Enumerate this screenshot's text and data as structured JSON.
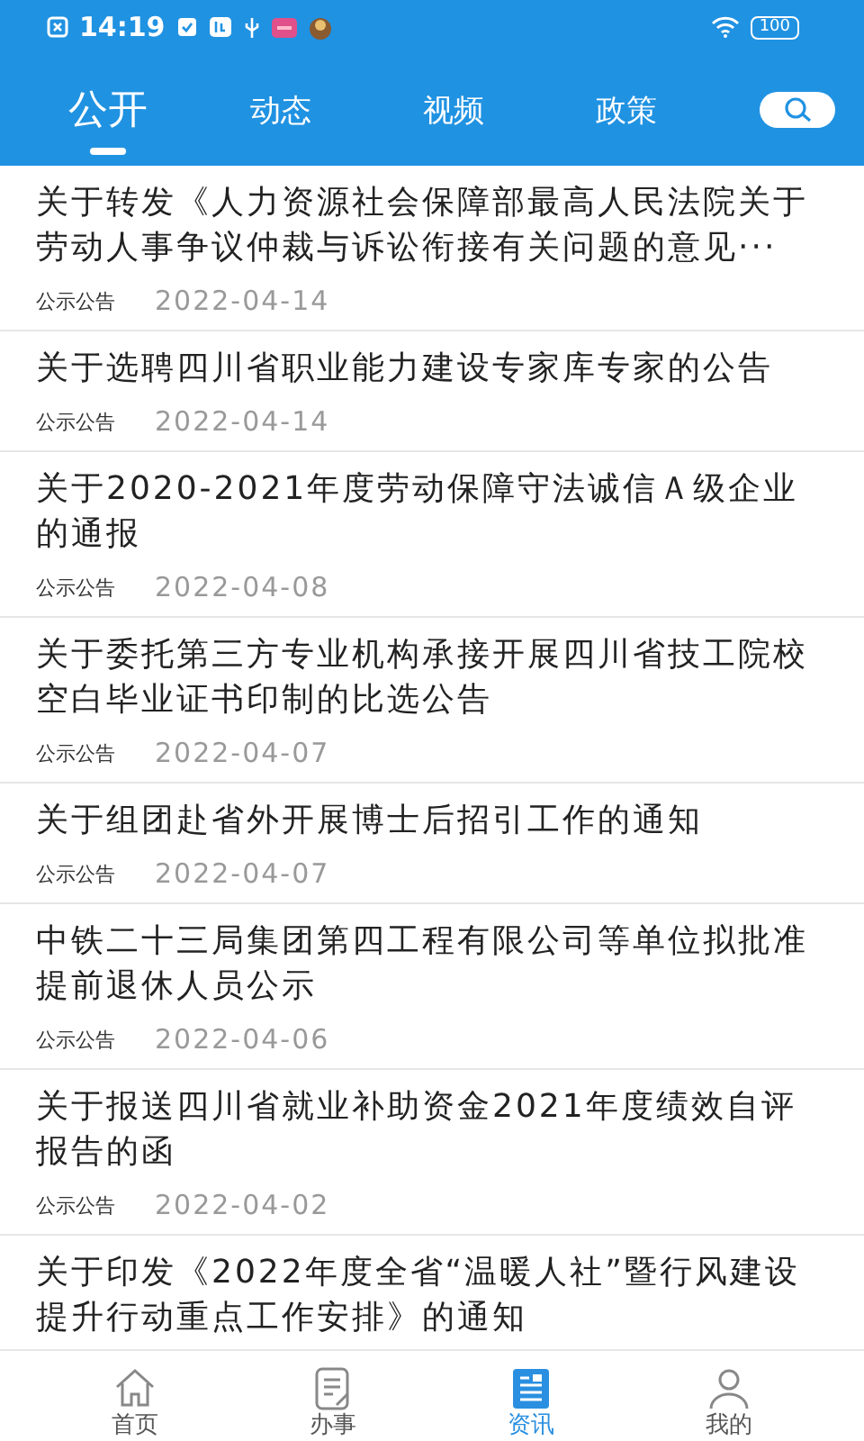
{
  "status_bar": {
    "time": "14:19",
    "battery": "100"
  },
  "tabs": [
    {
      "label": "公开",
      "selected": true
    },
    {
      "label": "动态",
      "selected": false
    },
    {
      "label": "视频",
      "selected": false
    },
    {
      "label": "政策",
      "selected": false
    }
  ],
  "articles": [
    {
      "title": "关于转发《人力资源社会保障部最高人民法院关于劳动人事争议仲裁与诉讼衔接有关问题的意见···",
      "category": "公示公告",
      "date": "2022-04-14"
    },
    {
      "title": "关于选聘四川省职业能力建设专家库专家的公告",
      "category": "公示公告",
      "date": "2022-04-14"
    },
    {
      "title": "关于2020-2021年度劳动保障守法诚信Ａ级企业的通报",
      "category": "公示公告",
      "date": "2022-04-08"
    },
    {
      "title": "关于委托第三方专业机构承接开展四川省技工院校空白毕业证书印制的比选公告",
      "category": "公示公告",
      "date": "2022-04-07"
    },
    {
      "title": "关于组团赴省外开展博士后招引工作的通知",
      "category": "公示公告",
      "date": "2022-04-07"
    },
    {
      "title": "中铁二十三局集团第四工程有限公司等单位拟批准提前退休人员公示",
      "category": "公示公告",
      "date": "2022-04-06"
    },
    {
      "title": "关于报送四川省就业补助资金2021年度绩效自评报告的函",
      "category": "公示公告",
      "date": "2022-04-02"
    },
    {
      "title": "关于印发《2022年度全省“温暖人社”暨行风建设提升行动重点工作安排》的通知"
    }
  ],
  "bottom_nav": [
    {
      "label": "首页",
      "selected": false
    },
    {
      "label": "办事",
      "selected": false
    },
    {
      "label": "资讯",
      "selected": true
    },
    {
      "label": "我的",
      "selected": false
    }
  ]
}
